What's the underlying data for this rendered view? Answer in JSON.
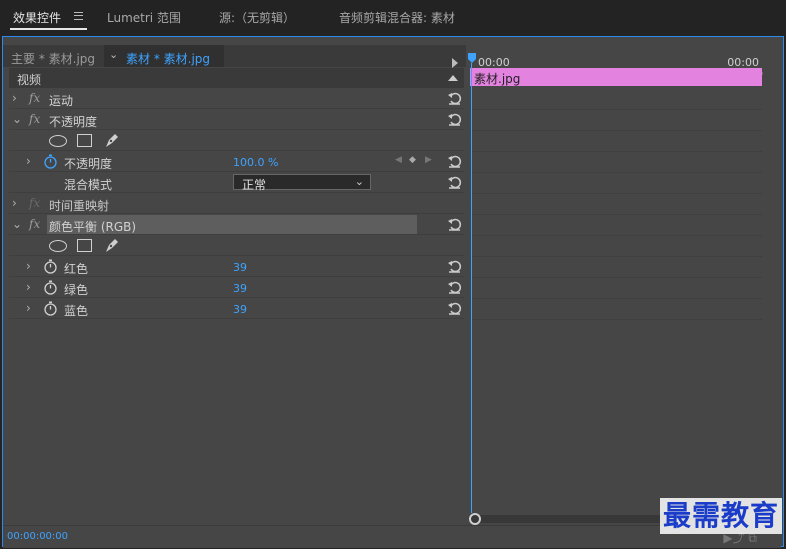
{
  "tabs": [
    {
      "label": "效果控件"
    },
    {
      "label": "Lumetri 范围"
    },
    {
      "label": "源:（无剪辑）"
    },
    {
      "label": "音频剪辑混合器: 素材"
    }
  ],
  "clip_bar": {
    "master": "主要 * 素材.jpg",
    "current": "素材 * 素材.jpg"
  },
  "video_section": "视频",
  "effects": {
    "motion": "运动",
    "opacity": "不透明度",
    "opacity_prop": "不透明度",
    "opacity_value": "100.0 %",
    "blend_mode": "混合模式",
    "blend_value": "正常",
    "time_remap": "时间重映射",
    "color_balance": "颜色平衡 (RGB)",
    "red": "红色",
    "red_value": "39",
    "green": "绿色",
    "green_value": "39",
    "blue": "蓝色",
    "blue_value": "39"
  },
  "timeline": {
    "start_tc": "00:00",
    "end_tc": "00:00",
    "clip_label": "素材.jpg",
    "clip_color": "#e482e0"
  },
  "footer": {
    "timecode": "00:00:00:00"
  },
  "watermark": "最需教育",
  "accent": "#2d8ceb"
}
